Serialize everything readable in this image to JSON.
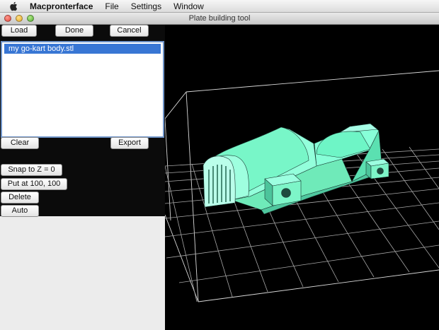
{
  "menubar": {
    "apple_icon": "apple-icon",
    "app_name": "Macpronterface",
    "items": [
      "File",
      "Settings",
      "Window"
    ]
  },
  "window": {
    "title": "Plate building tool"
  },
  "toolbar": {
    "load": "Load",
    "done": "Done",
    "cancel": "Cancel"
  },
  "file_list": {
    "items": [
      "my go-kart body.stl"
    ],
    "selected_index": 0
  },
  "actions": {
    "clear": "Clear",
    "export": "Export",
    "snap": "Snap to Z = 0",
    "put_at": "Put at 100, 100",
    "delete": "Delete",
    "auto": "Auto"
  },
  "viewport": {
    "model_color": "#7fffd4",
    "grid_color": "#ffffff",
    "background_color": "#000000"
  }
}
